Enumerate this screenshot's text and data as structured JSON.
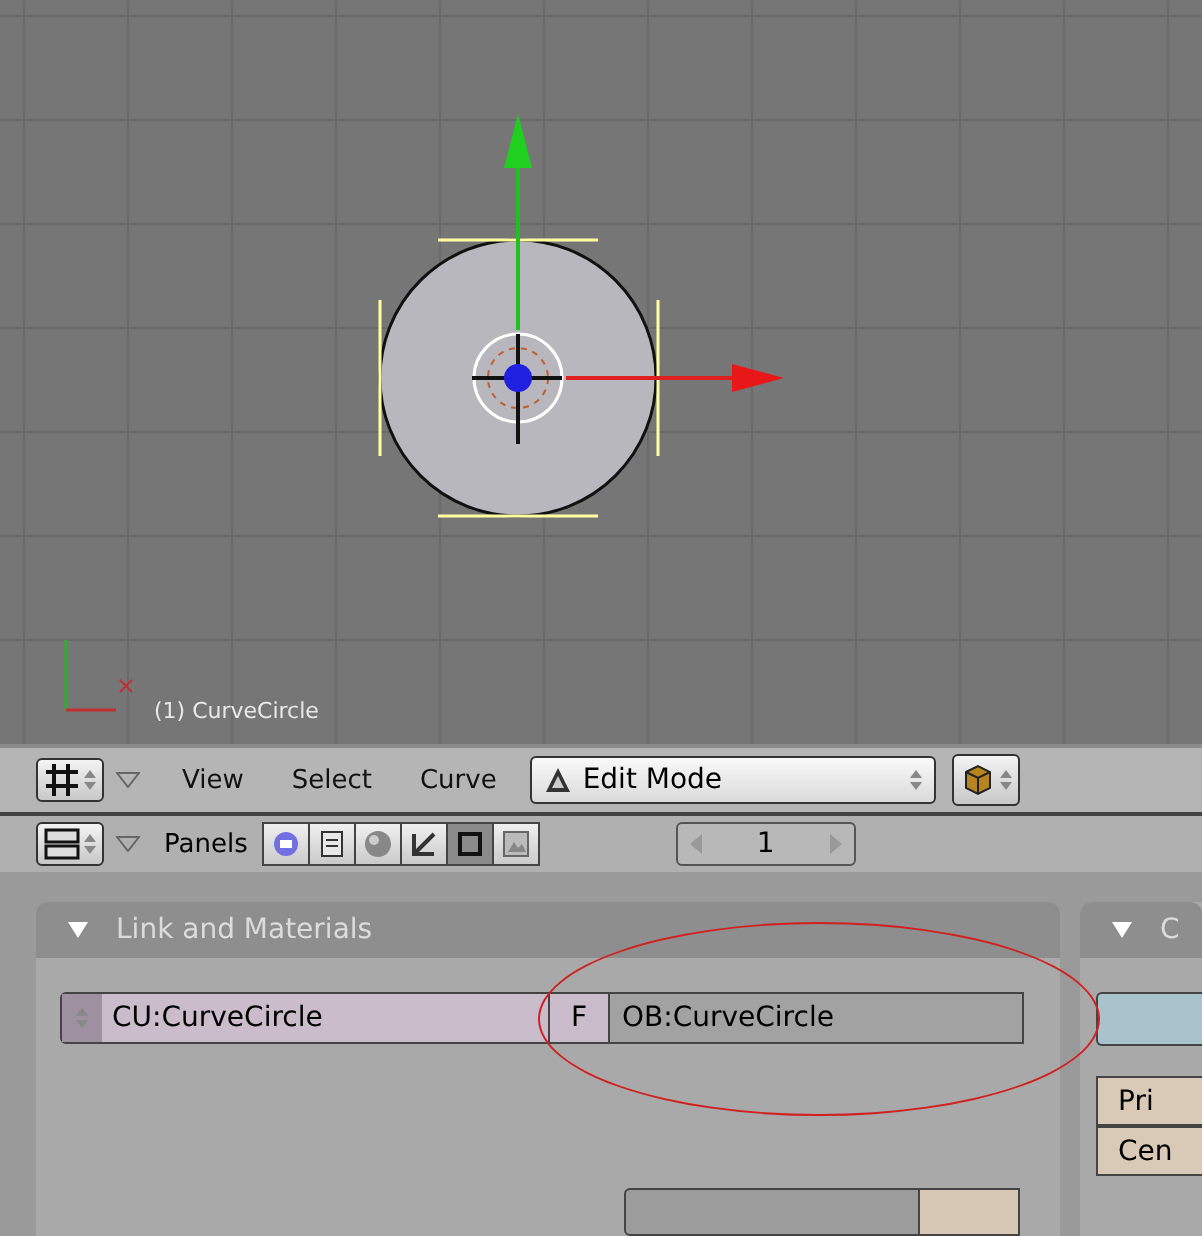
{
  "viewport": {
    "object_label": "(1) CurveCircle"
  },
  "header": {
    "menus": [
      "View",
      "Select",
      "Curve"
    ],
    "mode": "Edit Mode"
  },
  "buttons_header": {
    "label": "Panels",
    "contexts": [
      {
        "selected": false
      },
      {
        "selected": false
      },
      {
        "selected": false
      },
      {
        "selected": false
      },
      {
        "selected": true
      },
      {
        "selected": false
      }
    ],
    "frame": "1"
  },
  "panel": {
    "title": "Link and Materials",
    "expanded": true,
    "curve_field": "CU:CurveCircle",
    "fake_user_button": "F",
    "object_field": "OB:CurveCircle"
  },
  "side_panel": {
    "title": "C",
    "expanded": true,
    "buttons": [
      "Pri",
      "Cen"
    ]
  }
}
